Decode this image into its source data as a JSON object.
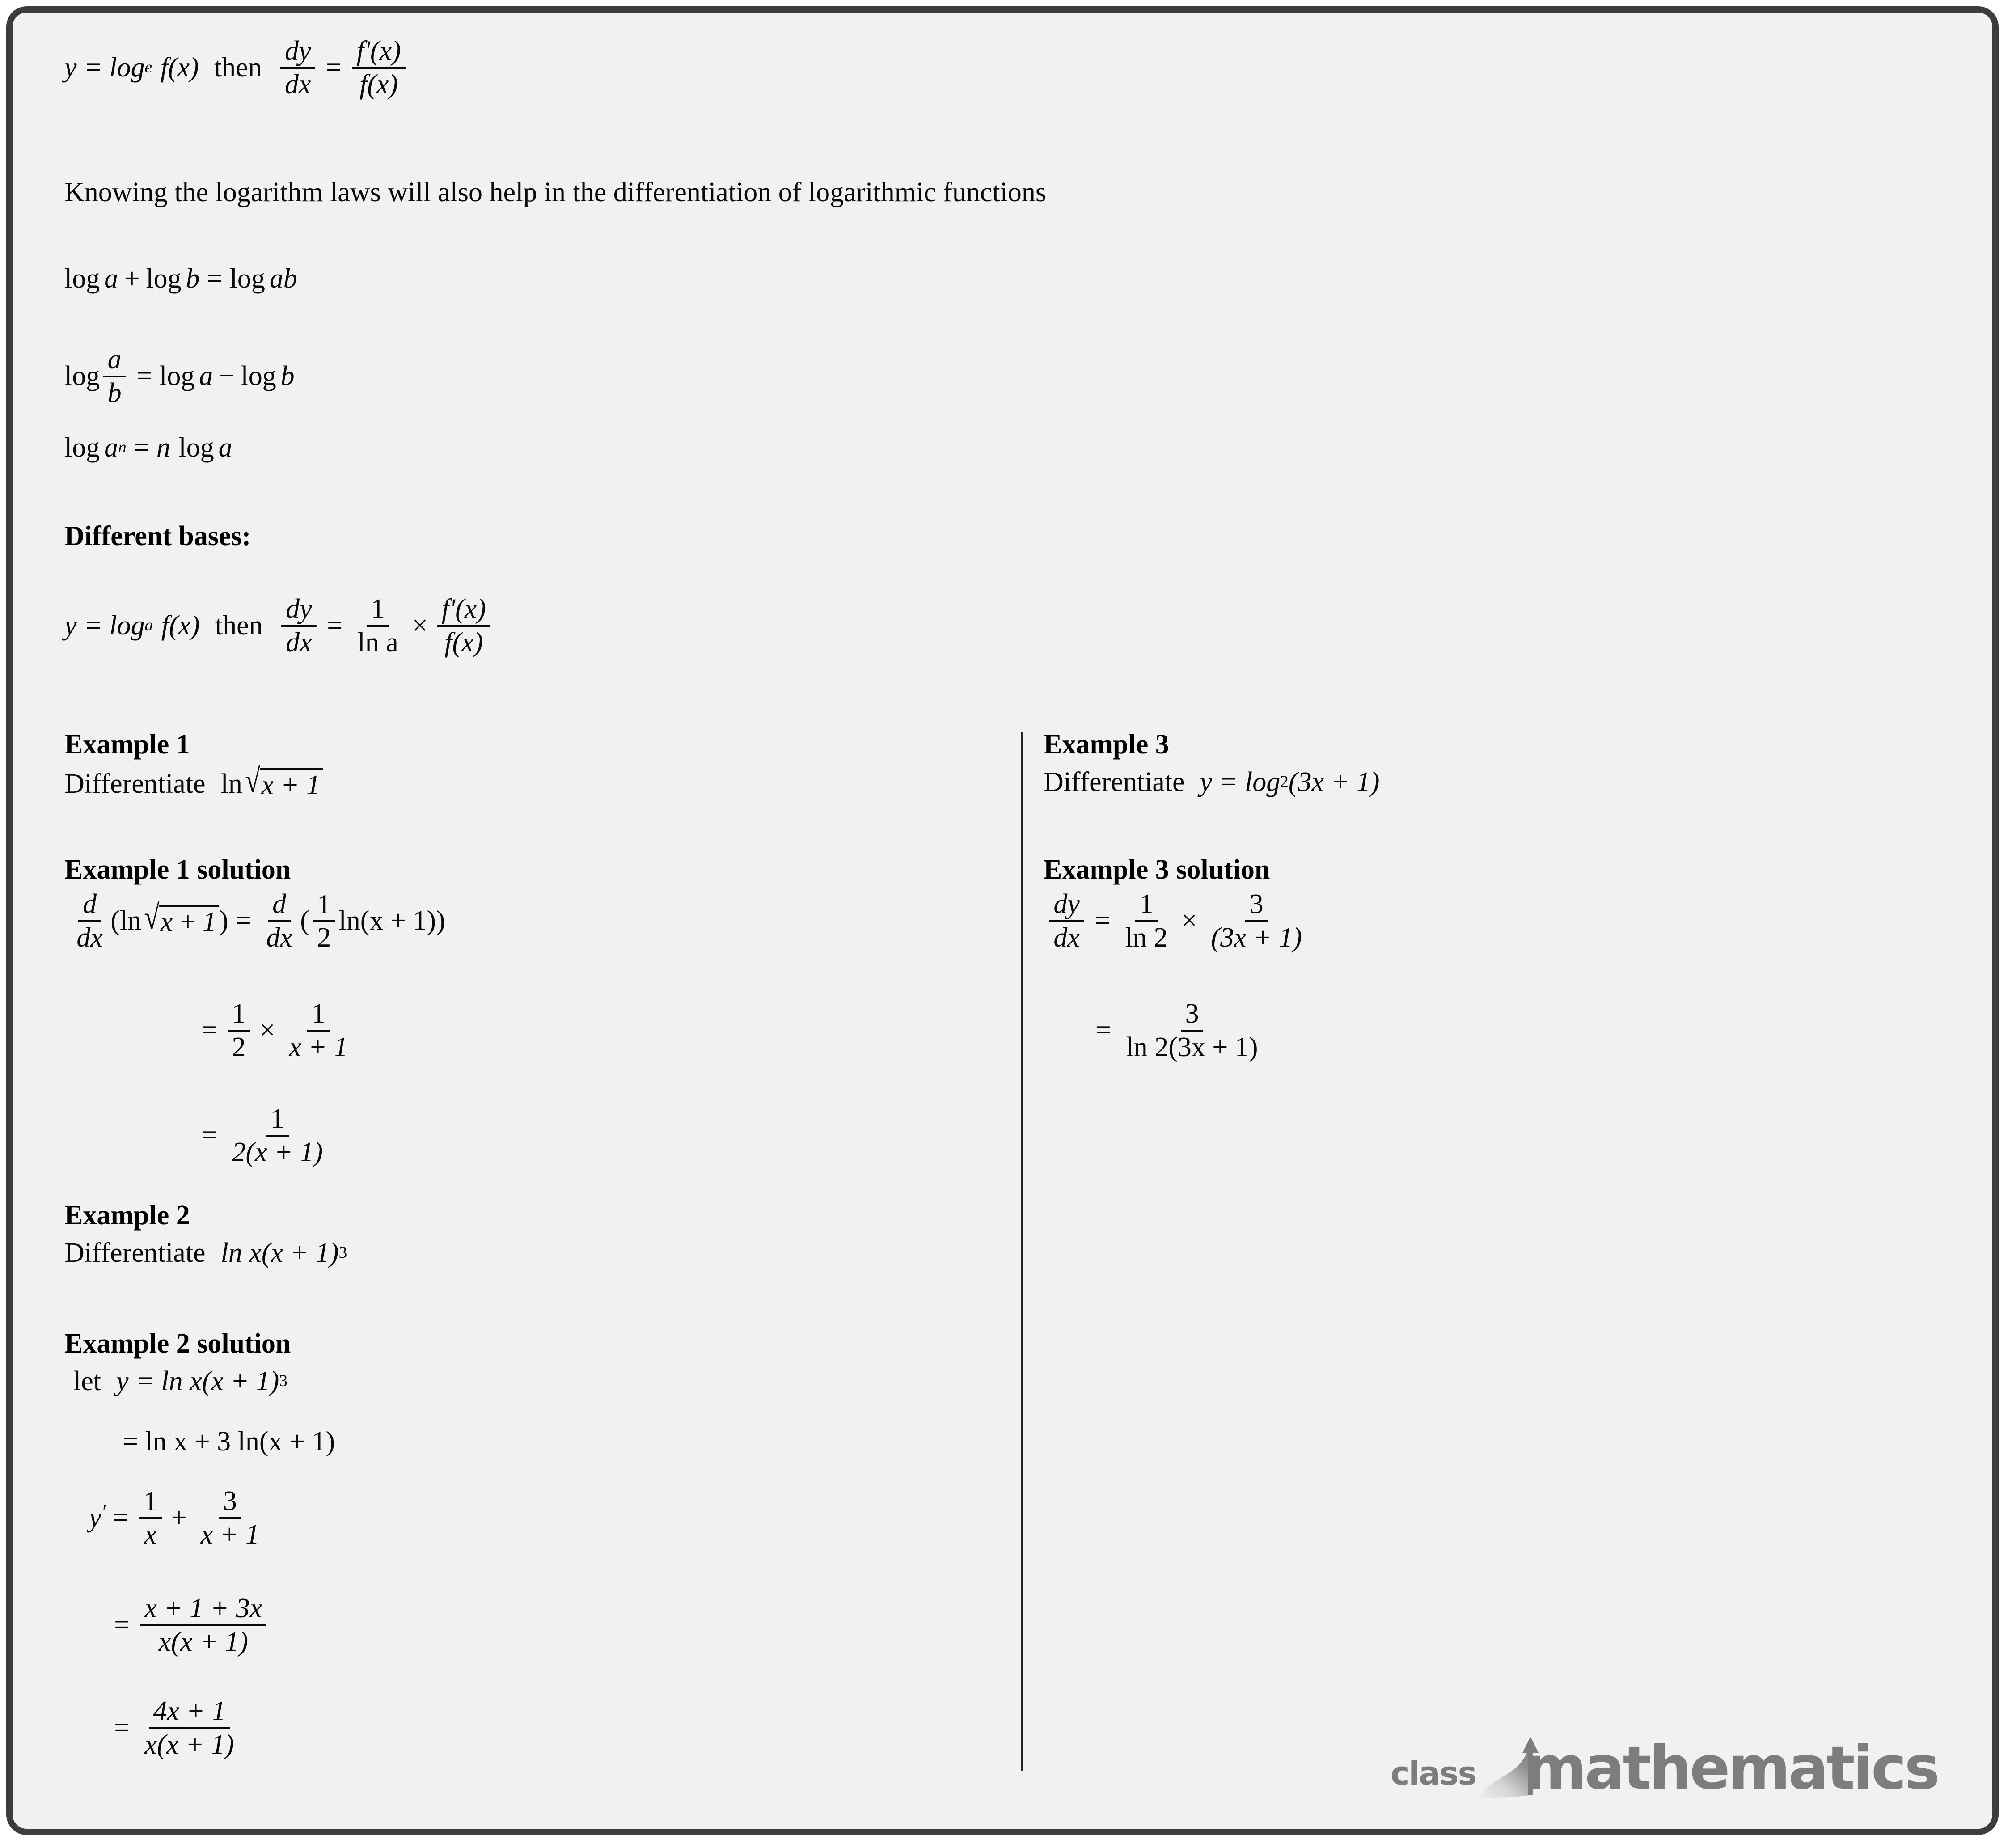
{
  "page": {
    "background_color": "#f1f1f0",
    "border_color": "#3d3d3d",
    "text_color": "#0a0a0a"
  },
  "intro": {
    "rule_lhs": "y = log",
    "rule_base": "e",
    "rule_fx": "f(x)",
    "rule_then": "then",
    "rule_dy": "dy",
    "rule_dx": "dx",
    "rule_eq": "=",
    "rule_num": "f'(x)",
    "rule_den": "f(x)",
    "note": "Knowing the logarithm laws will also help in the differentiation of logarithmic functions"
  },
  "log_laws": [
    {
      "text": "log a + log b = log ab"
    },
    {
      "text": "log a/b = log a - log b"
    },
    {
      "text": "log a^n = n log a"
    }
  ],
  "different_bases": {
    "heading": "Different bases:",
    "lhs": "y = log",
    "base": "a",
    "fx": "f(x)",
    "then": "then",
    "dy": "dy",
    "dx": "dx",
    "eq": "=",
    "one": "1",
    "lna": "ln a",
    "times": "×",
    "num": "f'(x)",
    "den": "f(x)"
  },
  "example1": {
    "heading": "Example 1",
    "prompt_text": "Differentiate",
    "prompt_fn_ln": "ln",
    "prompt_radicand": "x + 1",
    "solution_heading": "Example 1 solution",
    "line1": {
      "d": "d",
      "dx": "dx",
      "lhs_inner": "(ln √x + 1)",
      "eq": "=",
      "rhs_d": "d",
      "rhs_dx": "dx",
      "rhs_open": "(",
      "rhs_frac_num": "1",
      "rhs_frac_den": "2",
      "rhs_tail": "ln(x + 1))"
    },
    "line2": {
      "eq": "=",
      "f1_num": "1",
      "f1_den": "2",
      "times": "×",
      "f2_num": "1",
      "f2_den": "x + 1"
    },
    "line3": {
      "eq": "=",
      "num": "1",
      "den": "2(x + 1)"
    }
  },
  "example2": {
    "heading": "Example 2",
    "prompt_text": "Differentiate",
    "prompt_expr": "ln x(x + 1)",
    "prompt_power": "3",
    "solution_heading": "Example 2 solution",
    "line1_let": "let",
    "line1_expr": "y = ln x(x + 1)",
    "line1_power": "3",
    "line2": "= ln x + 3 ln(x + 1)",
    "line3": {
      "yprime": "y",
      "prime": "′",
      "eq": "=",
      "f1_num": "1",
      "f1_den": "x",
      "plus": "+",
      "f2_num": "3",
      "f2_den": "x + 1"
    },
    "line4": {
      "eq": "=",
      "num": "x + 1 + 3x",
      "den": "x(x + 1)"
    },
    "line5": {
      "eq": "=",
      "num": "4x + 1",
      "den": "x(x + 1)"
    }
  },
  "example3": {
    "heading": "Example 3",
    "prompt_text": "Differentiate",
    "prompt_lhs": "y = log",
    "prompt_base": "2",
    "prompt_rhs": "(3x + 1)",
    "solution_heading": "Example 3 solution",
    "line1": {
      "dy": "dy",
      "dx": "dx",
      "eq": "=",
      "f1_num": "1",
      "f1_den": "ln 2",
      "times": "×",
      "f2_num": "3",
      "f2_den": "(3x + 1)"
    },
    "line2": {
      "eq": "=",
      "num": "3",
      "den": "ln 2(3x + 1)"
    }
  },
  "logo": {
    "word1": "class",
    "word2": "mathematics",
    "color": "#7d7d7d",
    "icon": "arrow-swoosh-icon"
  }
}
